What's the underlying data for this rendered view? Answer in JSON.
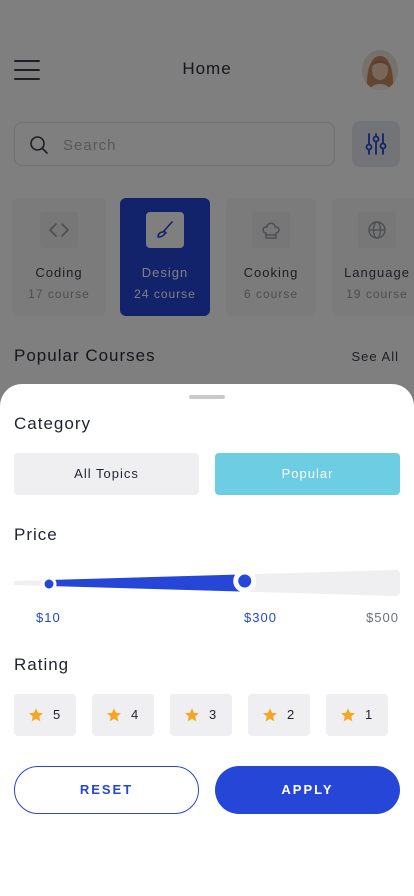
{
  "header": {
    "title": "Home"
  },
  "search": {
    "placeholder": "Search"
  },
  "categories": [
    {
      "name": "Coding",
      "count": "17 course",
      "icon": "code-icon"
    },
    {
      "name": "Design",
      "count": "24 course",
      "icon": "brush-icon"
    },
    {
      "name": "Cooking",
      "count": "6 course",
      "icon": "chef-hat-icon"
    },
    {
      "name": "Language",
      "count": "19 course",
      "icon": "globe-icon"
    }
  ],
  "popular": {
    "heading": "Popular Courses",
    "see_all": "See All"
  },
  "filter": {
    "category_label": "Category",
    "category_options": [
      "All Topics",
      "Popular"
    ],
    "selected_category": "Popular",
    "price_label": "Price",
    "price": {
      "min_label": "$10",
      "selected_label": "$300",
      "max_label": "$500",
      "min": 10,
      "selected": 300,
      "max": 500
    },
    "rating_label": "Rating",
    "ratings": [
      "5",
      "4",
      "3",
      "2",
      "1"
    ],
    "reset_label": "RESET",
    "apply_label": "APPLY"
  },
  "colors": {
    "accent": "#2546d6",
    "popular_chip": "#6ccde3",
    "star": "#f5a623"
  }
}
